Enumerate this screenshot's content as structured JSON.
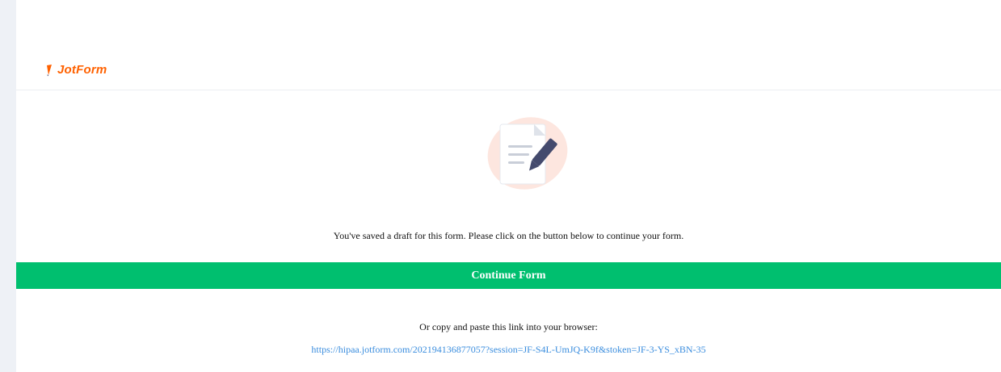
{
  "header": {
    "logo_text": "JotForm"
  },
  "message": {
    "draft_saved": "You've saved a draft for this form. Please click on the button below to continue your form."
  },
  "actions": {
    "continue_label": "Continue Form"
  },
  "link_section": {
    "instruction": "Or copy and paste this link into your browser:",
    "url": "https://hipaa.jotform.com/202194136877057?session=JF-S4L-UmJQ-K9f&stoken=JF-3-YS_xBN-35"
  },
  "colors": {
    "brand": "#ff6100",
    "button": "#00bf6f",
    "link": "#3a8dde"
  },
  "icons": {
    "logo": "jotform-pencil-icon",
    "illustration": "document-edit-icon"
  }
}
